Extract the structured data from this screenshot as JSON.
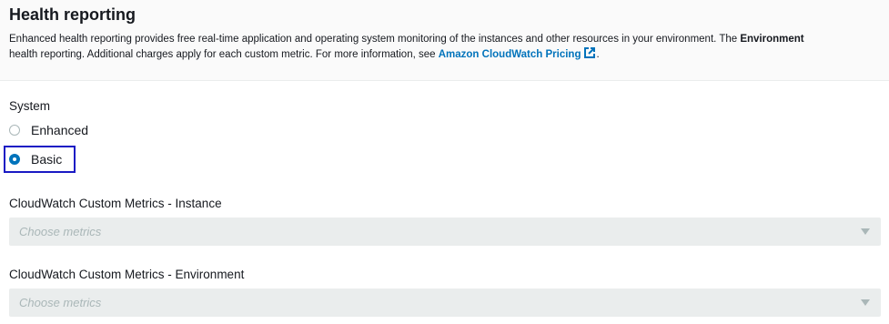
{
  "section": {
    "title": "Health reporting",
    "desc_line1_prefix": "Enhanced health reporting provides free real-time application and operating system monitoring of the instances and other resources in your environment. The ",
    "desc_line1_bold": "Environment",
    "desc_line2_prefix": "health reporting. Additional charges apply for each custom metric. For more information, see ",
    "desc_link": "Amazon CloudWatch Pricing",
    "desc_line2_suffix": "."
  },
  "system": {
    "label": "System",
    "options": [
      {
        "label": "Enhanced",
        "selected": false
      },
      {
        "label": "Basic",
        "selected": true
      }
    ]
  },
  "instance_metrics": {
    "label": "CloudWatch Custom Metrics - Instance",
    "placeholder": "Choose metrics"
  },
  "environment_metrics": {
    "label": "CloudWatch Custom Metrics - Environment",
    "placeholder": "Choose metrics"
  },
  "colors": {
    "accent": "#0073bb",
    "focus": "#1a1ac4",
    "disabled_bg": "#eaeded",
    "placeholder": "#aab7b8"
  },
  "icons": {
    "external_link": "external-link-icon",
    "dropdown": "caret-down-icon"
  }
}
